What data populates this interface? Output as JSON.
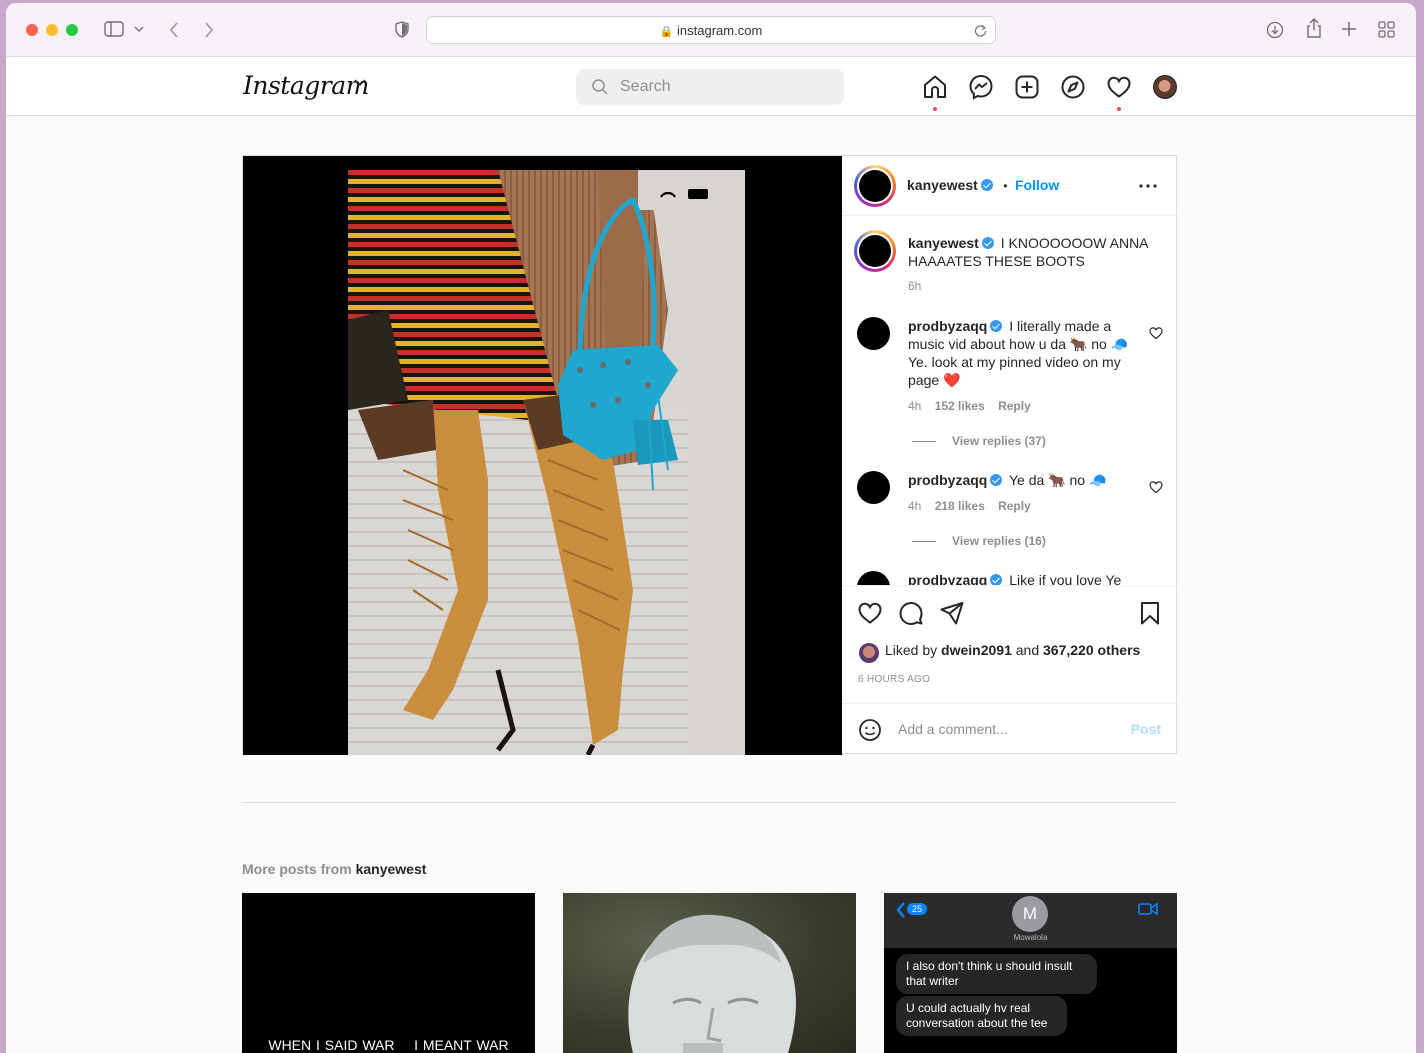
{
  "browser": {
    "url": "instagram.com"
  },
  "header": {
    "logo": "Instagram",
    "search_placeholder": "Search"
  },
  "post": {
    "author": "kanyewest",
    "follow_label": "Follow",
    "separator": "•",
    "caption": {
      "user": "kanyewest",
      "text": "I KNOOOOOOW ANNA HAAAATES THESE BOOTS",
      "time": "6h"
    },
    "comments": [
      {
        "user": "prodbyzaqq",
        "text": "I literally made a music vid about how u da 🐂 no 🧢 Ye. look at my pinned video on my page ❤️",
        "time": "4h",
        "likes": "152 likes",
        "reply_label": "Reply",
        "view_replies": "View replies (37)"
      },
      {
        "user": "prodbyzaqq",
        "text": "Ye da 🐂 no 🧢",
        "time": "4h",
        "likes": "218 likes",
        "reply_label": "Reply",
        "view_replies": "View replies (16)"
      },
      {
        "user": "prodbyzaqq",
        "text": "Like if you love Ye"
      }
    ],
    "liked_by_prefix": "Liked by",
    "liked_by_user": "dwein2091",
    "liked_by_and": "and",
    "liked_by_others": "367,220 others",
    "posted_ago": "6 HOURS AGO",
    "add_comment_placeholder": "Add a comment...",
    "post_button": "Post"
  },
  "more_posts": {
    "prefix": "More posts from",
    "user": "kanyewest",
    "thumb1_caption": "WHEN I SAID WAR    I MEANT WAR",
    "thumb3_contact": "Mowalola",
    "thumb3_contact_initial": "M",
    "thumb3_badge": "25",
    "thumb3_msg1": "I also don't think u should insult that writer",
    "thumb3_msg2": "U could actually hv real conversation about the tee"
  },
  "colors": {
    "accent": "#0095f6",
    "notification": "#ed4956",
    "bag_blue": "#1fa7cf",
    "boot_tan": "#c98d3e"
  }
}
